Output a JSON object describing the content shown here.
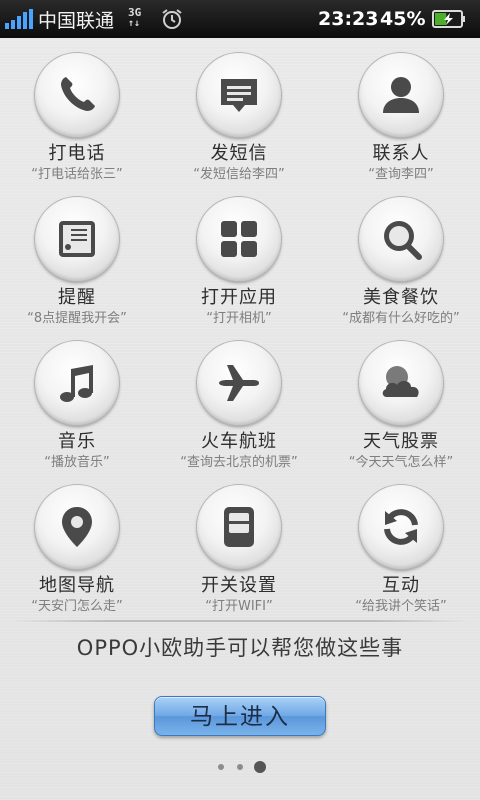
{
  "status_bar": {
    "carrier": "中国联通",
    "network_type_top": "3G",
    "network_type_bottom": "↑↓",
    "time": "23:23",
    "battery_percent": "45%",
    "battery_level": 0.45,
    "signal_bars": 5
  },
  "features": [
    {
      "label": "打电话",
      "hint": "“打电话给张三”",
      "icon": "phone-icon"
    },
    {
      "label": "发短信",
      "hint": "“发短信给李四”",
      "icon": "message-icon"
    },
    {
      "label": "联系人",
      "hint": "“查询李四”",
      "icon": "contact-icon"
    },
    {
      "label": "提醒",
      "hint": "“8点提醒我开会”",
      "icon": "reminder-icon"
    },
    {
      "label": "打开应用",
      "hint": "“打开相机”",
      "icon": "apps-icon"
    },
    {
      "label": "美食餐饮",
      "hint": "“成都有什么好吃的”",
      "icon": "magnifier-icon"
    },
    {
      "label": "音乐",
      "hint": "“播放音乐”",
      "icon": "music-note-icon"
    },
    {
      "label": "火车航班",
      "hint": "“查询去北京的机票”",
      "icon": "airplane-icon"
    },
    {
      "label": "天气股票",
      "hint": "“今天天气怎么样”",
      "icon": "weather-icon"
    },
    {
      "label": "地图导航",
      "hint": "“天安门怎么走”",
      "icon": "map-pin-icon"
    },
    {
      "label": "开关设置",
      "hint": "“打开WIFI”",
      "icon": "switch-icon"
    },
    {
      "label": "互动",
      "hint": "“给我讲个笑话”",
      "icon": "refresh-icon"
    }
  ],
  "tagline": "OPPO小欧助手可以帮您做这些事",
  "enter_button": "马上进入",
  "pager": {
    "pages": 3,
    "current": 3
  },
  "colors": {
    "accent": "#6fa8e6",
    "icon": "#4a4a4a",
    "battery": "#4caf2a"
  }
}
